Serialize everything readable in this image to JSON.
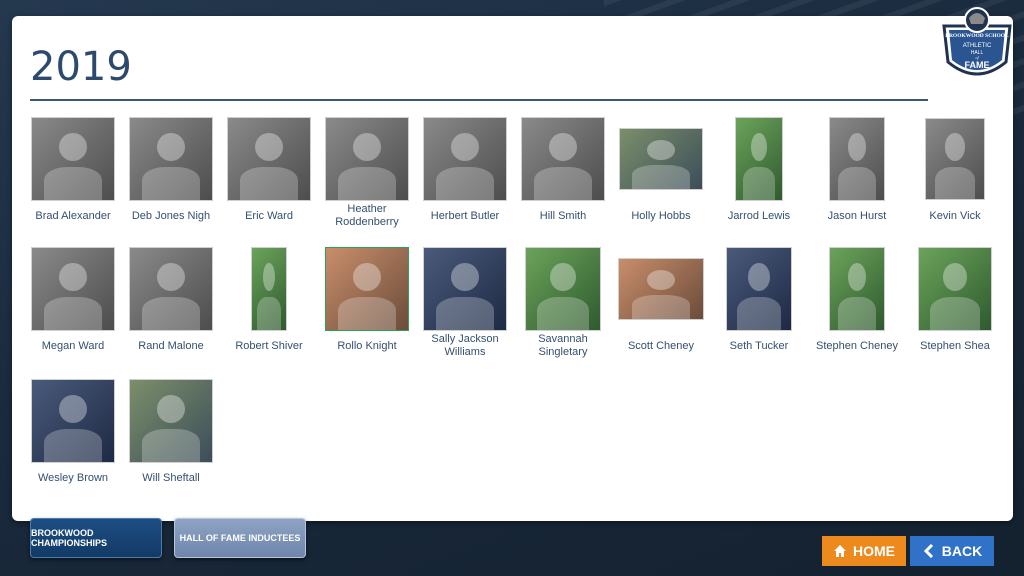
{
  "page": {
    "year": "2019"
  },
  "logo": {
    "school": "BROOKWOOD SCHOOL",
    "line1": "ATHLETIC",
    "line2": "HALL",
    "line3": "of",
    "line4": "FAME"
  },
  "inductees": [
    {
      "name": "Brad Alexander"
    },
    {
      "name": "Deb Jones Nigh"
    },
    {
      "name": "Eric Ward"
    },
    {
      "name": "Heather Roddenberry"
    },
    {
      "name": "Herbert Butler"
    },
    {
      "name": "Hill Smith"
    },
    {
      "name": "Holly Hobbs"
    },
    {
      "name": "Jarrod Lewis"
    },
    {
      "name": "Jason Hurst"
    },
    {
      "name": "Kevin Vick"
    },
    {
      "name": "Megan Ward"
    },
    {
      "name": "Rand Malone"
    },
    {
      "name": "Robert Shiver"
    },
    {
      "name": "Rollo Knight"
    },
    {
      "name": "Sally Jackson Williams"
    },
    {
      "name": "Savannah Singletary"
    },
    {
      "name": "Scott Cheney"
    },
    {
      "name": "Seth Tucker"
    },
    {
      "name": "Stephen Cheney"
    },
    {
      "name": "Stephen Shea"
    },
    {
      "name": "Wesley Brown"
    },
    {
      "name": "Will Sheftall"
    }
  ],
  "tabs": {
    "championships": "BROOKWOOD CHAMPIONSHIPS",
    "inductees": "HALL OF FAME INDUCTEES"
  },
  "nav": {
    "home": "HOME",
    "back": "BACK"
  },
  "colors": {
    "home": "#ec8a1e",
    "back": "#2f72c7",
    "title": "#2d4a6e"
  }
}
